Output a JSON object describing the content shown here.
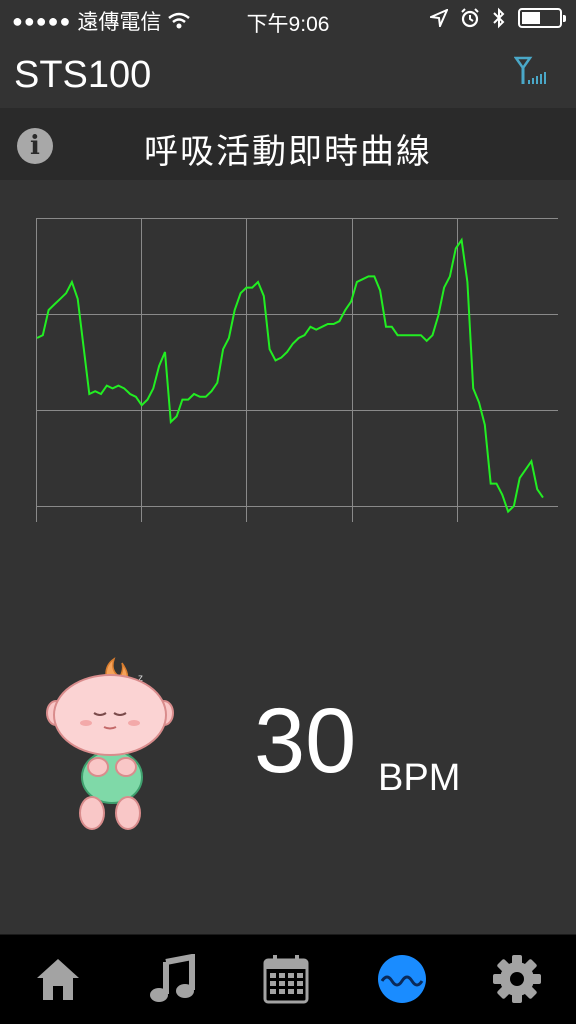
{
  "status_bar": {
    "signal_dots": "●●●●●",
    "carrier": "遠傳電信",
    "time": "下午9:06",
    "battery_level": 0.5,
    "icons": [
      "wifi-icon",
      "location-arrow-icon",
      "alarm-icon",
      "bluetooth-icon",
      "battery-icon"
    ]
  },
  "app": {
    "title": "STS100",
    "connection_icon": "antenna-signal-icon"
  },
  "title_bar": {
    "info_glyph": "i",
    "title": "呼吸活動即時曲線"
  },
  "chart_data": {
    "type": "line",
    "grid": true,
    "line_color": "#22ee22",
    "grid_color": "#8a8a8a",
    "x": [
      0,
      1,
      2,
      3,
      4,
      5,
      6,
      7,
      8,
      9,
      10,
      11,
      12,
      13,
      14,
      15,
      16,
      17,
      18,
      19,
      20,
      21,
      22,
      23,
      24,
      25,
      26,
      27,
      28,
      29,
      30,
      31,
      32,
      33,
      34,
      35,
      36,
      37,
      38,
      39,
      40,
      41,
      42,
      43,
      44,
      45,
      46,
      47,
      48,
      49,
      50,
      51,
      52,
      53,
      54,
      55,
      56,
      57,
      58,
      59,
      60,
      61,
      62,
      63,
      64,
      65,
      66,
      67,
      68,
      69,
      70,
      71,
      72,
      73,
      74,
      75,
      76,
      77,
      78,
      79,
      80,
      81,
      82,
      83,
      84,
      85,
      86,
      87,
      88,
      89,
      90,
      91,
      92,
      93,
      94,
      95,
      96,
      97,
      98,
      99,
      100
    ],
    "series": [
      {
        "values": [
          0.6,
          0.61,
          0.7,
          0.72,
          0.74,
          0.76,
          0.8,
          0.74,
          0.57,
          0.4,
          0.41,
          0.4,
          0.43,
          0.42,
          0.43,
          0.42,
          0.4,
          0.39,
          0.36,
          0.38,
          0.42,
          0.5,
          0.55,
          0.3,
          0.32,
          0.38,
          0.38,
          0.4,
          0.39,
          0.39,
          0.41,
          0.44,
          0.56,
          0.6,
          0.7,
          0.76,
          0.78,
          0.78,
          0.8,
          0.75,
          0.56,
          0.52,
          0.53,
          0.55,
          0.58,
          0.6,
          0.61,
          0.64,
          0.63,
          0.64,
          0.65,
          0.65,
          0.66,
          0.7,
          0.73,
          0.8,
          0.81,
          0.82,
          0.82,
          0.77,
          0.64,
          0.64,
          0.61,
          0.61,
          0.61,
          0.61,
          0.61,
          0.59,
          0.61,
          0.68,
          0.78,
          0.82,
          0.92,
          0.95,
          0.8,
          0.42,
          0.37,
          0.29,
          0.08,
          0.08,
          0.04,
          -0.02,
          0.0,
          0.1,
          0.13,
          0.16,
          0.06,
          0.03
        ]
      }
    ],
    "ylim": [
      0,
      1
    ]
  },
  "reading": {
    "value": "30",
    "unit": "BPM",
    "mascot_icon": "sleeping-baby-icon"
  },
  "tabs": [
    {
      "name": "home",
      "icon": "home-icon",
      "active": false
    },
    {
      "name": "music",
      "icon": "music-note-icon",
      "active": false
    },
    {
      "name": "calendar",
      "icon": "calendar-icon",
      "active": false
    },
    {
      "name": "breathing-wave",
      "icon": "wave-icon",
      "active": true
    },
    {
      "name": "settings",
      "icon": "gear-icon",
      "active": false
    }
  ],
  "colors": {
    "background": "#333333",
    "header_dark": "#2a2a2a",
    "tab_bar": "#000000",
    "tab_icon": "#a3a3a3",
    "accent": "#1a8cff",
    "chart_line": "#22ee22"
  }
}
